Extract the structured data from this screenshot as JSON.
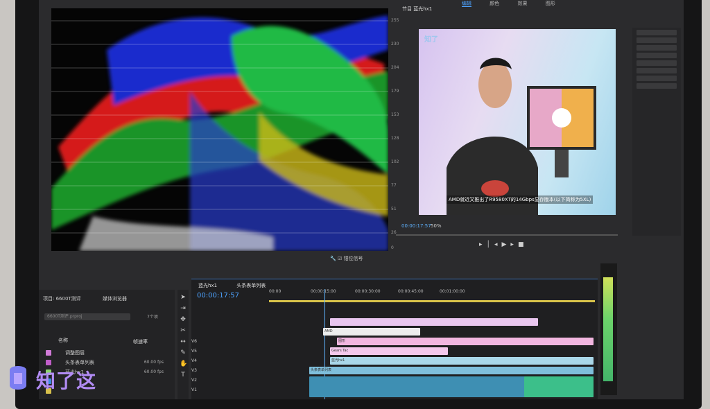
{
  "program_monitor": {
    "title": "节目 蓝光hx1",
    "timecode": "00:00:17:57",
    "fit": "50%",
    "subtitle": "AMD就近又推出了R9580XT的14Gbps显存版本(以下简称为5XL)",
    "watermark": "知了"
  },
  "workspace_tabs": {
    "active": "编辑",
    "items": [
      "颜色",
      "效果",
      "图形"
    ]
  },
  "scope": {
    "scale": [
      "255",
      "230",
      "204",
      "179",
      "153",
      "128",
      "102",
      "77",
      "51",
      "26",
      "0"
    ],
    "clamp_label": "钳位信号"
  },
  "project_panel": {
    "tab": "项目: 6600T测评",
    "tab2": "媒体浏览器",
    "search_placeholder": "6600T测评.prproj",
    "item_count": "7个项",
    "col_name": "名称",
    "col_rate": "帧速率",
    "items": [
      {
        "name": "调整图层",
        "rate": "",
        "color": "#d27bd9"
      },
      {
        "name": "头条表单列表",
        "rate": "60.00 fps",
        "color": "#c15ec9"
      },
      {
        "name": "蓝光hx1",
        "rate": "60.00 fps",
        "color": "#8dd66d"
      },
      {
        "name": "",
        "rate": "",
        "color": "#3b8ee0"
      },
      {
        "name": "",
        "rate": "",
        "color": "#d7c04b"
      }
    ]
  },
  "timeline": {
    "tab1": "蓝光hx1",
    "tab2": "头条表单列表",
    "timecode": "00:00:17:57",
    "ruler": [
      "00:00",
      "00:00:15:00",
      "00:00:30:00",
      "00:00:45:00",
      "00:01:00:00"
    ],
    "tracks": [
      "V6",
      "V5",
      "V4",
      "V3",
      "V2",
      "V1"
    ],
    "clip_labels": [
      "AMD",
      "图形",
      "Gears Tac",
      "蓝光hx1",
      "头条表单列表"
    ]
  },
  "logo": {
    "text": "知了这"
  }
}
